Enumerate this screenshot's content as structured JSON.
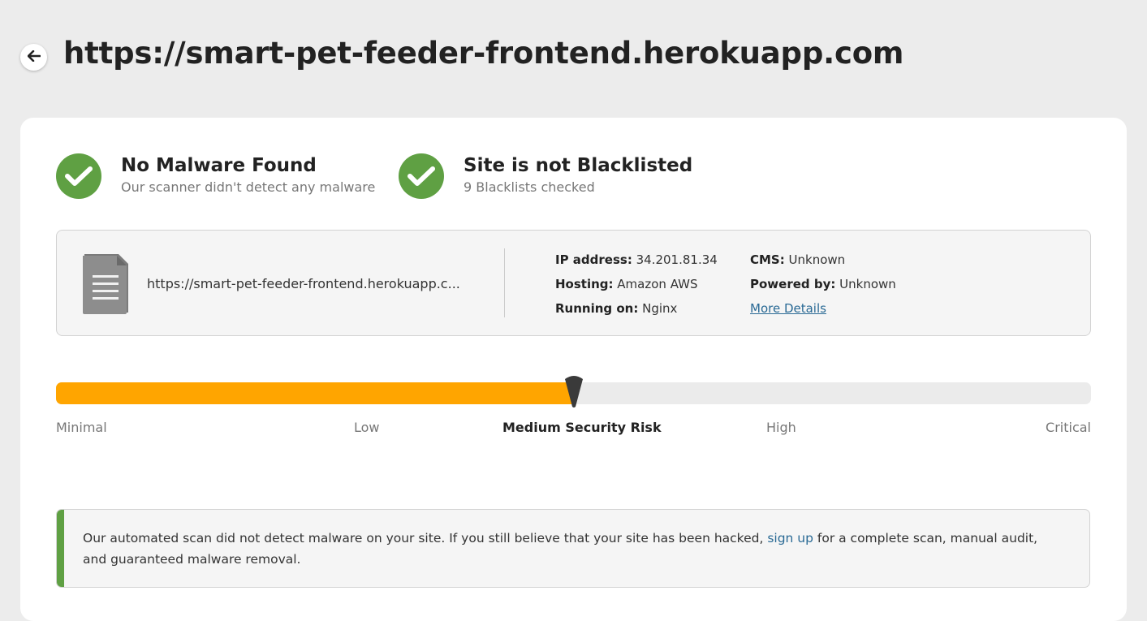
{
  "header": {
    "title": "https://smart-pet-feeder-frontend.herokuapp.com",
    "back_icon": "arrow-left-icon"
  },
  "status_cards": [
    {
      "icon": "checkmark-icon",
      "title": "No Malware Found",
      "subtitle": "Our scanner didn't detect any malware"
    },
    {
      "icon": "checkmark-icon",
      "title": "Site is not Blacklisted",
      "subtitle": "9 Blacklists checked"
    }
  ],
  "site_info": {
    "icon": "document-icon",
    "url": "https://smart-pet-feeder-frontend.herokuapp.c...",
    "ip_label": "IP address:",
    "ip_value": "34.201.81.34",
    "hosting_label": "Hosting:",
    "hosting_value": "Amazon AWS",
    "running_label": "Running on:",
    "running_value": "Nginx",
    "cms_label": "CMS:",
    "cms_value": "Unknown",
    "powered_label": "Powered by:",
    "powered_value": "Unknown",
    "more_details": "More Details"
  },
  "risk": {
    "level_fraction": 0.5,
    "labels": [
      "Minimal",
      "Low",
      "Medium Security Risk",
      "High",
      "Critical"
    ],
    "active_index": 2
  },
  "notice": {
    "text_before": "Our automated scan did not detect malware on your site. If you still believe that your site has been hacked, ",
    "link": "sign up",
    "text_after": " for a complete scan, manual audit, and guaranteed malware removal."
  },
  "colors": {
    "success": "#5fa043",
    "risk_fill": "#ffa500",
    "link": "#2a6a95"
  }
}
